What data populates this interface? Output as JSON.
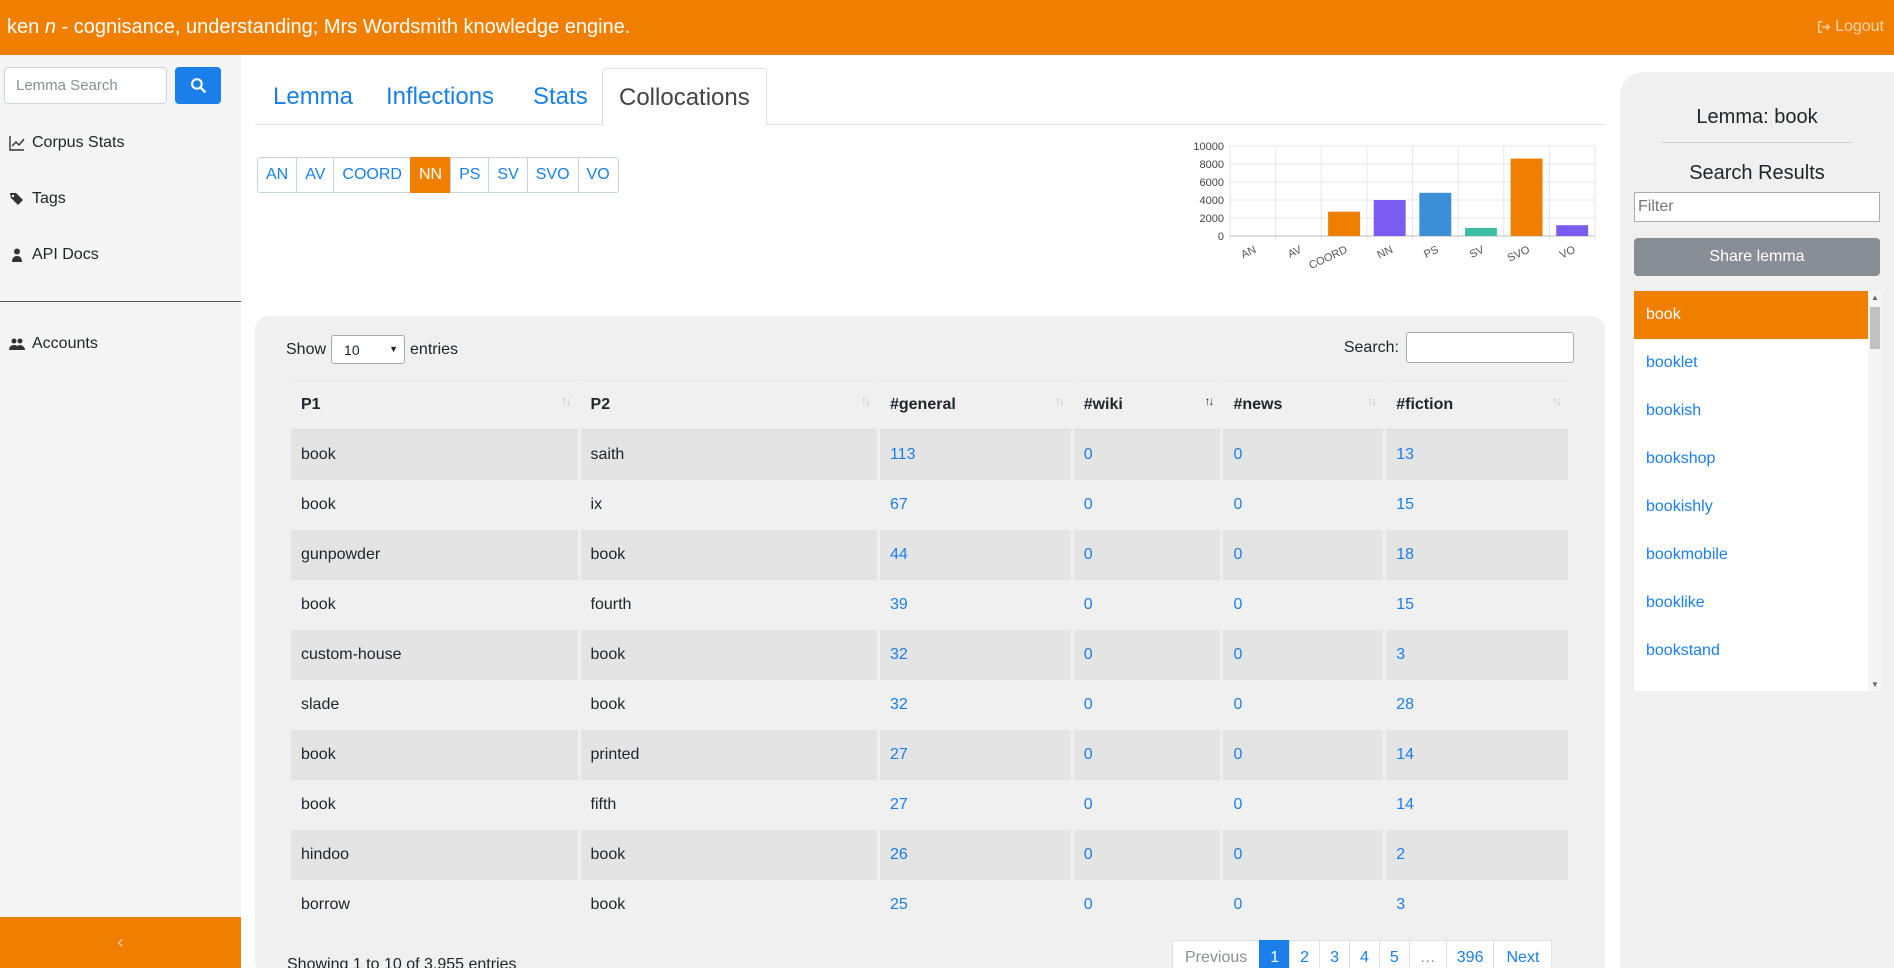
{
  "header": {
    "brand_prefix": "ken",
    "brand_pos": "n",
    "brand_suffix": "- cognisance, understanding; Mrs Wordsmith knowledge engine.",
    "logout_label": "Logout"
  },
  "sidebar": {
    "search_placeholder": "Lemma Search",
    "items": [
      {
        "label": "Corpus Stats",
        "icon": "chart-line-icon"
      },
      {
        "label": "Tags",
        "icon": "tags-icon"
      },
      {
        "label": "API Docs",
        "icon": "user-doc-icon"
      },
      {
        "label": "Accounts",
        "icon": "users-icon"
      }
    ],
    "collapse_glyph": "‹"
  },
  "tabs": [
    "Lemma",
    "Inflections",
    "Stats",
    "Collocations"
  ],
  "active_tab": "Collocations",
  "relations": {
    "buttons": [
      "AN",
      "AV",
      "COORD",
      "NN",
      "PS",
      "SV",
      "SVO",
      "VO"
    ],
    "active": "NN"
  },
  "chart_data": {
    "type": "bar",
    "categories": [
      "AN",
      "AV",
      "COORD",
      "NN",
      "PS",
      "SV",
      "SVO",
      "VO"
    ],
    "values": [
      0,
      0,
      2700,
      4000,
      4800,
      900,
      8600,
      1200
    ],
    "colors": [
      "#f07f00",
      "#f07f00",
      "#f07f00",
      "#7b5cf0",
      "#3a8fd6",
      "#3cbfa0",
      "#f07f00",
      "#7b5cf0"
    ],
    "ylim": [
      0,
      10000
    ],
    "yticks": [
      0,
      2000,
      4000,
      6000,
      8000,
      10000
    ],
    "title": "",
    "xlabel": "",
    "ylabel": "",
    "grid": true
  },
  "table": {
    "show_label": "Show",
    "page_size": "10",
    "entries_label": "entries",
    "search_label": "Search:",
    "columns": [
      "P1",
      "P2",
      "#general",
      "#wiki",
      "#news",
      "#fiction"
    ],
    "rows": [
      [
        "book",
        "saith",
        "113",
        "0",
        "0",
        "13"
      ],
      [
        "book",
        "ix",
        "67",
        "0",
        "0",
        "15"
      ],
      [
        "gunpowder",
        "book",
        "44",
        "0",
        "0",
        "18"
      ],
      [
        "book",
        "fourth",
        "39",
        "0",
        "0",
        "15"
      ],
      [
        "custom-house",
        "book",
        "32",
        "0",
        "0",
        "3"
      ],
      [
        "slade",
        "book",
        "32",
        "0",
        "0",
        "28"
      ],
      [
        "book",
        "printed",
        "27",
        "0",
        "0",
        "14"
      ],
      [
        "book",
        "fifth",
        "27",
        "0",
        "0",
        "14"
      ],
      [
        "hindoo",
        "book",
        "26",
        "0",
        "0",
        "2"
      ],
      [
        "borrow",
        "book",
        "25",
        "0",
        "0",
        "3"
      ]
    ],
    "info": "Showing 1 to 10 of 3,955 entries",
    "pagination": [
      "Previous",
      "1",
      "2",
      "3",
      "4",
      "5",
      "…",
      "396",
      "Next"
    ]
  },
  "right_panel": {
    "lemma_title": "Lemma: book",
    "results_title": "Search Results",
    "filter_placeholder": "Filter",
    "share_label": "Share lemma",
    "results": [
      "book",
      "booklet",
      "bookish",
      "bookshop",
      "bookishly",
      "bookmobile",
      "booklike",
      "bookstand"
    ]
  }
}
